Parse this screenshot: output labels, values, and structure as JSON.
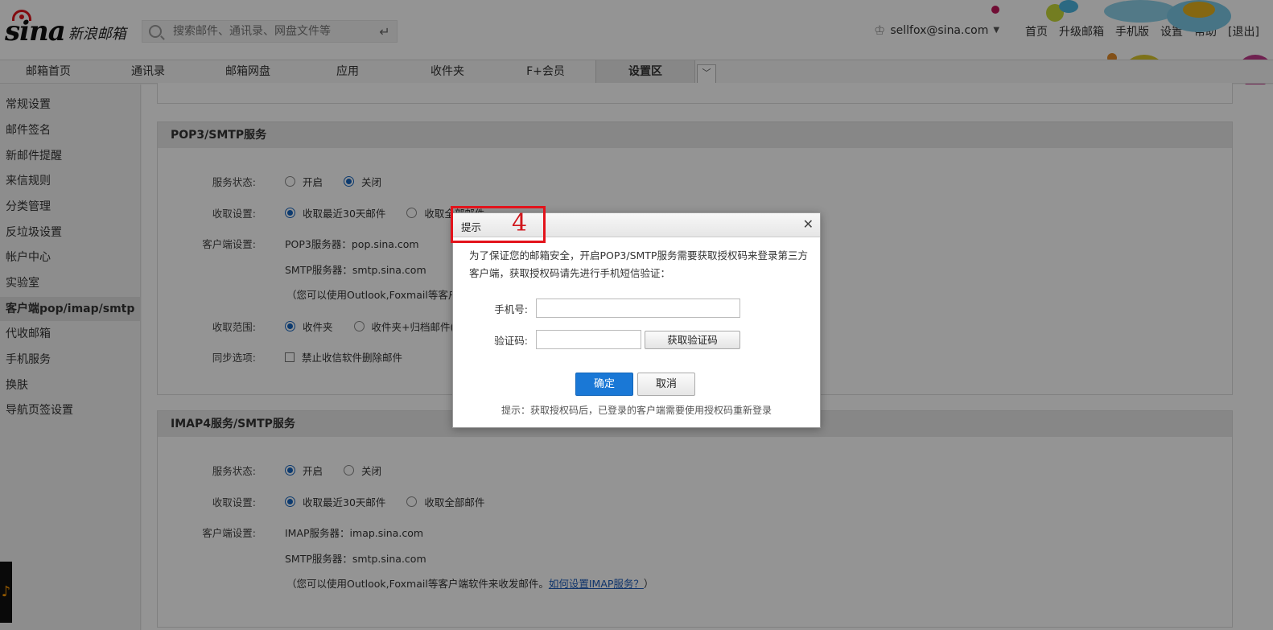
{
  "header": {
    "logo_mark": "sina",
    "logo_text": "新浪邮箱",
    "search_placeholder": "搜索邮件、通讯录、网盘文件等",
    "user_email": "sellfox@sina.com",
    "links": [
      "首页",
      "升级邮箱",
      "手机版",
      "设置",
      "帮助",
      "[退出]"
    ]
  },
  "nav": {
    "tabs": [
      "邮箱首页",
      "通讯录",
      "邮箱网盘",
      "应用",
      "收件夹",
      "F+会员",
      "设置区"
    ]
  },
  "sidebar": {
    "items": [
      "常规设置",
      "邮件签名",
      "新邮件提醒",
      "来信规则",
      "分类管理",
      "反垃圾设置",
      "帐户中心",
      "实验室",
      "客户端pop/imap/smtp",
      "代收邮箱",
      "手机服务",
      "换肤",
      "导航页签设置"
    ]
  },
  "pop3": {
    "title": "POP3/SMTP服务",
    "status_label": "服务状态:",
    "status_on": "开启",
    "status_off": "关闭",
    "receive_label": "收取设置:",
    "receive_30": "收取最近30天邮件",
    "receive_all": "收取全部邮件",
    "client_label": "客户端设置:",
    "pop_server": "POP3服务器：pop.sina.com",
    "smtp_server": "SMTP服务器：smtp.sina.com",
    "note": "（您可以使用Outlook,Foxmail等客户端",
    "scope_label": "收取范围:",
    "scope_inbox": "收件夹",
    "scope_archive": "收件夹+归档邮件(移",
    "sync_label": "同步选项:",
    "sync_option": "禁止收信软件删除邮件"
  },
  "imap": {
    "title": "IMAP4服务/SMTP服务",
    "status_label": "服务状态:",
    "status_on": "开启",
    "status_off": "关闭",
    "receive_label": "收取设置:",
    "receive_30": "收取最近30天邮件",
    "receive_all": "收取全部邮件",
    "client_label": "客户端设置:",
    "imap_server": "IMAP服务器：imap.sina.com",
    "smtp_server": "SMTP服务器：smtp.sina.com",
    "note_prefix": "（您可以使用Outlook,Foxmail等客户端软件来收发邮件。",
    "note_link": "如何设置IMAP服务？",
    "note_suffix": "）"
  },
  "dialog": {
    "title": "提示",
    "message": "为了保证您的邮箱安全，开启POP3/SMTP服务需要获取授权码来登录第三方客户端，获取授权码请先进行手机短信验证：",
    "phone_label": "手机号:",
    "code_label": "验证码:",
    "get_code": "获取验证码",
    "ok": "确定",
    "cancel": "取消",
    "tip": "提示：获取授权码后，已登录的客户端需要使用授权码重新登录"
  },
  "annotation": {
    "step": "4"
  },
  "colors": {
    "accent": "#1a78d6",
    "brand_red": "#e0161c",
    "annotation_red": "#e3131b"
  }
}
